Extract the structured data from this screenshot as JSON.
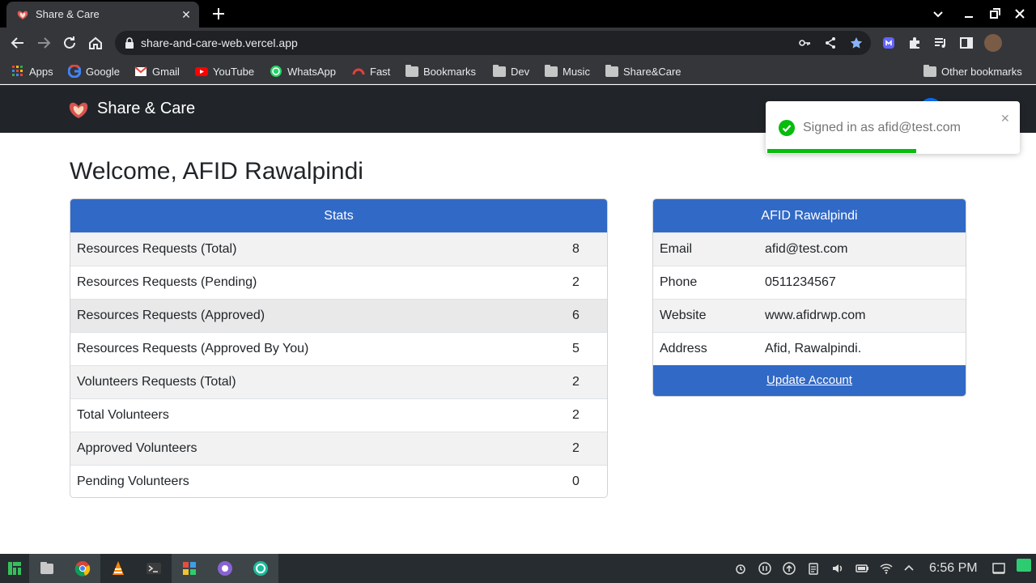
{
  "browser": {
    "tab_title": "Share & Care",
    "url": "share-and-care-web.vercel.app",
    "bookmarks": [
      {
        "label": "Apps",
        "icon": "apps-grid-icon"
      },
      {
        "label": "Google",
        "icon": "google-icon"
      },
      {
        "label": "Gmail",
        "icon": "gmail-icon"
      },
      {
        "label": "YouTube",
        "icon": "youtube-icon"
      },
      {
        "label": "WhatsApp",
        "icon": "whatsapp-icon"
      },
      {
        "label": "Fast",
        "icon": "speed-gauge-icon"
      },
      {
        "label": "Bookmarks",
        "icon": "folder-icon"
      },
      {
        "label": "Dev",
        "icon": "folder-icon"
      },
      {
        "label": "Music",
        "icon": "folder-icon"
      },
      {
        "label": "Share&Care",
        "icon": "folder-icon"
      }
    ],
    "other_bookmarks": "Other bookmarks"
  },
  "site": {
    "brand": "Share & Care",
    "welcome": "Welcome, AFID Rawalpindi"
  },
  "stats": {
    "header": "Stats",
    "rows": [
      {
        "label": "Resources Requests (Total)",
        "value": "8"
      },
      {
        "label": "Resources Requests (Pending)",
        "value": "2"
      },
      {
        "label": "Resources Requests (Approved)",
        "value": "6"
      },
      {
        "label": "Resources Requests (Approved By You)",
        "value": "5"
      },
      {
        "label": "Volunteers Requests (Total)",
        "value": "2"
      },
      {
        "label": "Total Volunteers",
        "value": "2"
      },
      {
        "label": "Approved Volunteers",
        "value": "2"
      },
      {
        "label": "Pending Volunteers",
        "value": "0"
      }
    ]
  },
  "profile": {
    "header": "AFID Rawalpindi",
    "rows": [
      {
        "label": "Email",
        "value": "afid@test.com"
      },
      {
        "label": "Phone",
        "value": "0511234567"
      },
      {
        "label": "Website",
        "value": "www.afidrwp.com"
      },
      {
        "label": "Address",
        "value": "Afid, Rawalpindi."
      }
    ],
    "update_link": "Update Account"
  },
  "toast": {
    "message": "Signed in as afid@test.com",
    "progress": 0.59
  },
  "taskbar": {
    "time": "6:56 PM"
  },
  "colors": {
    "card_header": "#3169c6",
    "navbar": "#212529",
    "toast_success": "#07bc0c"
  }
}
